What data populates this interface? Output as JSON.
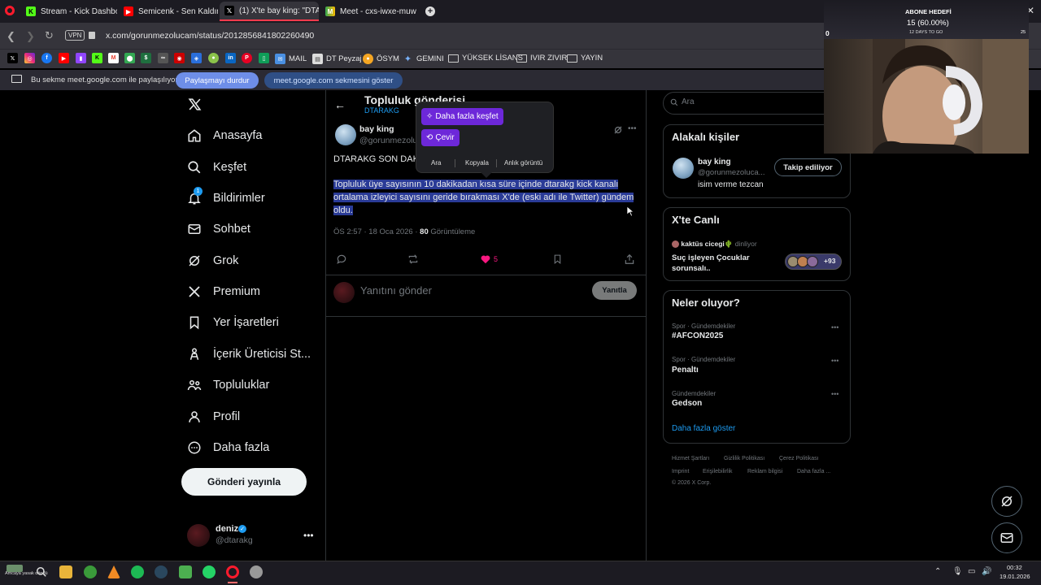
{
  "browser": {
    "tabs": [
      {
        "label": "Stream - Kick Dashboard",
        "icon": "kick-icon"
      },
      {
        "label": "Semicenk - Sen Kaldın (pr",
        "icon": "youtube-icon"
      },
      {
        "label": "(1) X'te bay king: \"DTARAI",
        "icon": "x-icon"
      },
      {
        "label": "Meet - cxs-iwxe-muw",
        "icon": "meet-icon"
      }
    ],
    "vpn": "VPN",
    "url": "x.com/gorunmezolucam/status/2012856841802260490",
    "bookmarks": [
      "MAIL",
      "DT Peyzaj",
      "ÖSYM",
      "GEMINI",
      "YÜKSEK LİSANS",
      "IVIR ZIVIR",
      "YAYIN"
    ],
    "share_bar": {
      "text": "Bu sekme meet.google.com ile paylaşılıyor",
      "stop": "Paylaşmayı durdur",
      "show": "meet.google.com sekmesini göster"
    }
  },
  "nav": {
    "items": [
      {
        "label": "Anasayfa",
        "icon": "home-icon"
      },
      {
        "label": "Keşfet",
        "icon": "search-icon"
      },
      {
        "label": "Bildirimler",
        "icon": "bell-icon",
        "badge": "1"
      },
      {
        "label": "Sohbet",
        "icon": "mail-icon"
      },
      {
        "label": "Grok",
        "icon": "grok-icon"
      },
      {
        "label": "Premium",
        "icon": "x-icon"
      },
      {
        "label": "Yer İşaretleri",
        "icon": "bookmark-icon"
      },
      {
        "label": "İçerik Üreticisi St...",
        "icon": "creator-icon"
      },
      {
        "label": "Topluluklar",
        "icon": "people-icon"
      },
      {
        "label": "Profil",
        "icon": "profile-icon"
      },
      {
        "label": "Daha fazla",
        "icon": "more-circle-icon"
      }
    ],
    "post_button": "Gönderi yayınla",
    "account": {
      "name": "deniz",
      "handle": "@dtarakg"
    }
  },
  "post": {
    "header_title": "Topluluk gönderisi",
    "community": "DTARAKG",
    "author": "bay king",
    "handle": "@gorunmezolucam",
    "line1": "DTARAKG SON DAKİKA",
    "body": "Topluluk üye sayısının 10 dakikadan kısa süre içinde dtarakg kick kanalı ortalama izleyici sayısını geride bırakması X'de (eski adı ile Twitter) gündem oldu.",
    "time": "ÖS 2:57 · 18 Oca 2026 · ",
    "views": "80",
    "views_label": " Görüntüleme",
    "likes": "5",
    "reply_placeholder": "Yanıtını gönder",
    "reply_button": "Yanıtla"
  },
  "popup": {
    "discover": "Daha fazla keşfet",
    "translate": "Çevir",
    "options": [
      "Ara",
      "Kopyala",
      "Anlık görüntü"
    ]
  },
  "right": {
    "search_placeholder": "Ara",
    "related_title": "Alakalı kişiler",
    "related": {
      "name": "bay king",
      "handle": "@gorunmezoluca...",
      "bio": "isim verme tezcan",
      "button": "Takip ediliyor"
    },
    "live_title": "X'te Canlı",
    "live": {
      "host": "kaktüs cicegi🌵",
      "status": " dinliyor",
      "title": "Suç işleyen Çocuklar sorunsalı..",
      "count": "+93"
    },
    "trends_title": "Neler oluyor?",
    "trends": [
      {
        "category": "Spor · Gündemdekiler",
        "name": "#AFCON2025"
      },
      {
        "category": "Spor · Gündemdekiler",
        "name": "Penaltı"
      },
      {
        "category": "Gündemdekiler",
        "name": "Gedson"
      }
    ],
    "show_more": "Daha fazla göster",
    "footer": [
      "Hizmet Şartları",
      "Gizlilik Politikası",
      "Çerez Politikası",
      "Imprint",
      "Erişilebilirlik",
      "Reklam bilgisi",
      "Daha fazla ...",
      "© 2026 X Corp."
    ]
  },
  "overlay": {
    "goal_title": "ABONE HEDEFİ",
    "goal_count": "15 (60.00%)",
    "goal_days": "12 DAYS TO GO",
    "goal_start": "0",
    "goal_end": "25"
  },
  "taskbar": {
    "weather": "Amcaya yasak döndü",
    "time": "00:32",
    "date": "19.01.2026"
  }
}
